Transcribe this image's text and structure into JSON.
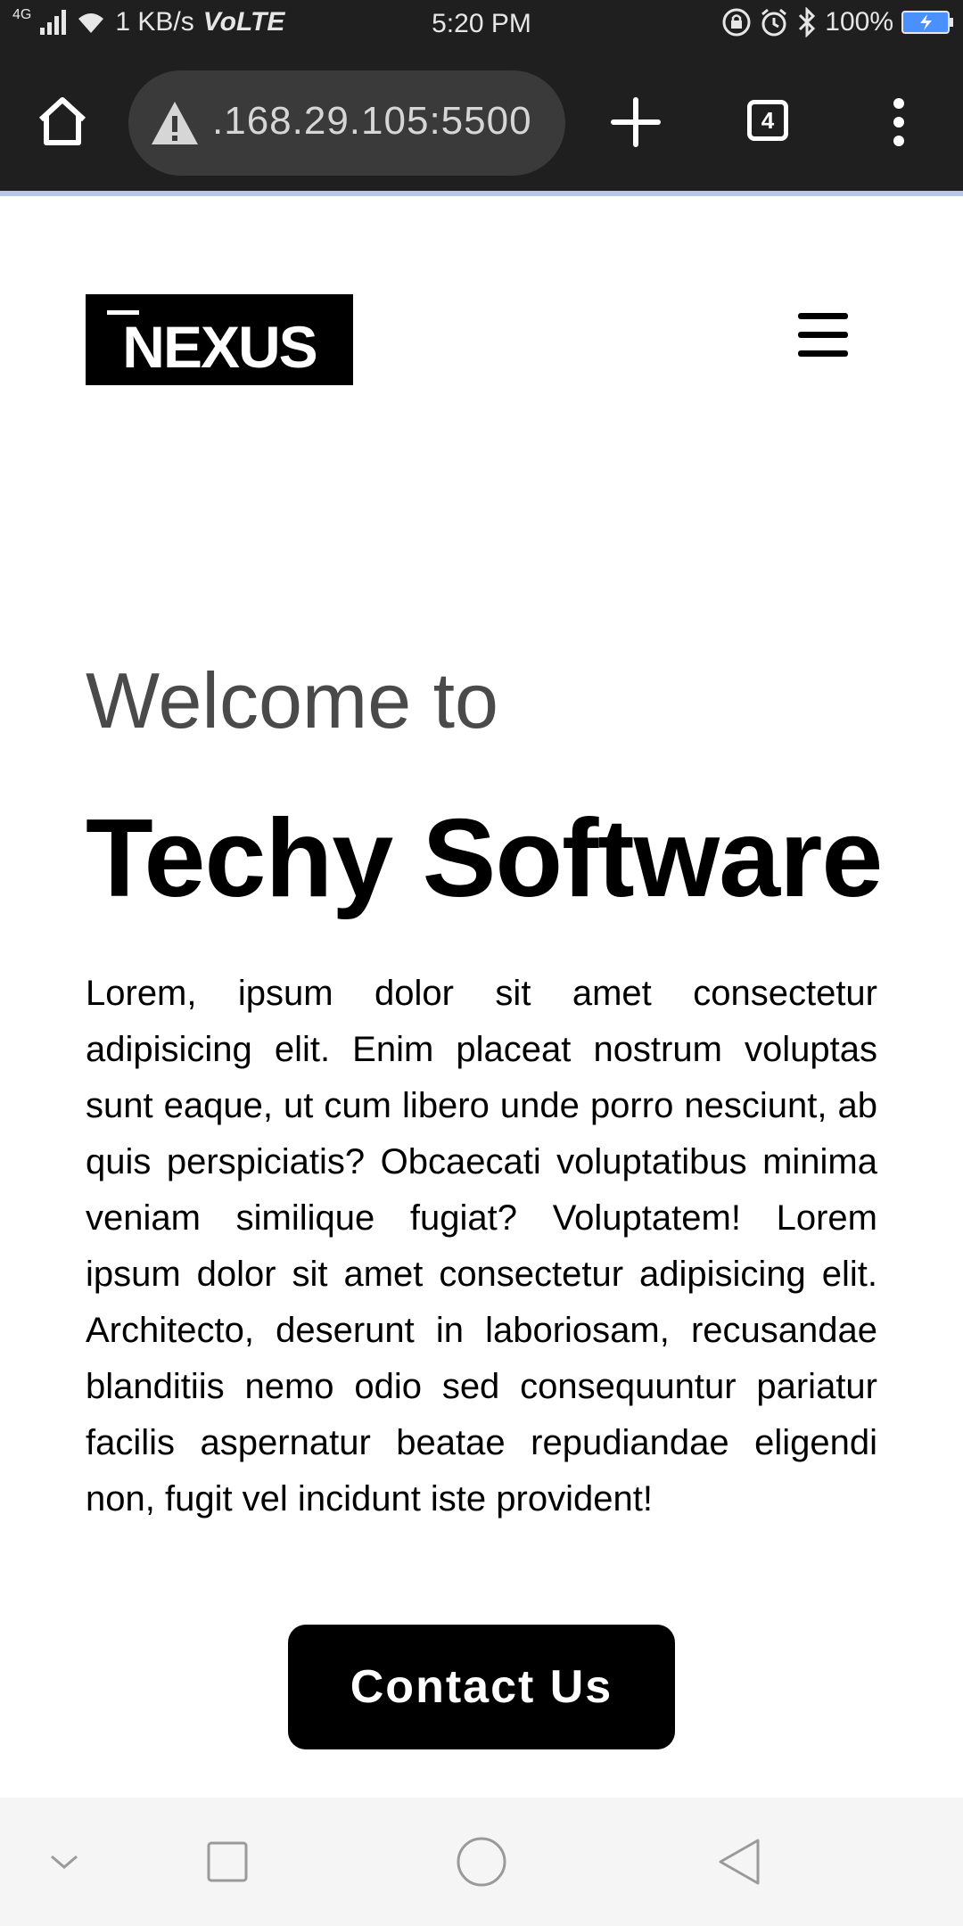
{
  "status_bar": {
    "network": "4G",
    "speed": "1 KB/s",
    "volte": "VoLTE",
    "time": "5:20 PM",
    "battery": "100%"
  },
  "browser": {
    "url": ".168.29.105:5500",
    "tab_count": "4"
  },
  "page": {
    "logo_text": "NEXUS",
    "welcome": "Welcome to",
    "headline": "Techy Software",
    "body": "Lorem, ipsum dolor sit amet consectetur adipisicing elit. Enim placeat nostrum voluptas sunt eaque, ut cum libero unde porro nesciunt, ab quis perspiciatis? Obcaecati voluptatibus minima veniam similique fugiat? Voluptatem! Lorem ipsum dolor sit amet consectetur adipisicing elit. Architecto, deserunt in laboriosam, recusandae blanditiis nemo odio sed consequuntur pariatur facilis aspernatur beatae repudiandae eligendi non, fugit vel incidunt iste provident!",
    "cta_label": "Contact Us"
  },
  "colors": {
    "chrome": "#1f1f1f",
    "url_pill": "#3a3a3a",
    "battery": "#4a90ff",
    "text": "#000000",
    "welcome_text": "#4a4a4a",
    "button_bg": "#000000",
    "nav_bar": "#f5f5f5"
  },
  "icons": {
    "status": [
      "signal-icon",
      "wifi-icon",
      "rotation-lock-icon",
      "alarm-icon",
      "bluetooth-icon",
      "battery-icon"
    ],
    "browser": [
      "home-icon",
      "warning-icon",
      "plus-icon",
      "tabs-icon",
      "more-vert-icon"
    ],
    "page": [
      "hamburger-menu-icon"
    ],
    "nav": [
      "collapse-icon",
      "recents-icon",
      "home-circle-icon",
      "back-icon"
    ]
  }
}
